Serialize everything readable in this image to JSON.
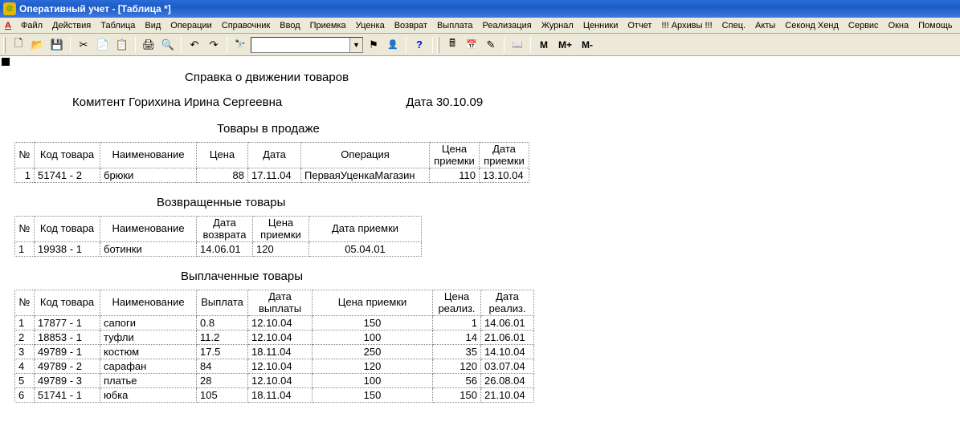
{
  "window": {
    "title": "Оперативный учет - [Таблица  *]"
  },
  "menu": [
    "Файл",
    "Действия",
    "Таблица",
    "Вид",
    "Операции",
    "Справочник",
    "Ввод",
    "Приемка",
    "Уценка",
    "Возврат",
    "Выплата",
    "Реализация",
    "Журнал",
    "Ценники",
    "Отчет",
    "!!! Архивы !!!",
    "Спец.",
    "Акты",
    "Секонд Хенд",
    "Сервис",
    "Окна",
    "Помощь"
  ],
  "tb": {
    "m": "M",
    "mplus": "M+",
    "mminus": "M-"
  },
  "report": {
    "title": "Справка о движении товаров",
    "komitent_label": "Комитент",
    "komitent_name": "Горихина Ирина Сергеевна",
    "date_label": "Дата",
    "date_value": "30.10.09"
  },
  "sections": {
    "sale": {
      "title": "Товары в продаже",
      "cols": [
        "№",
        "Код товара",
        "Наименование",
        "Цена",
        "Дата",
        "Операция",
        "Цена приемки",
        "Дата приемки"
      ],
      "rows": [
        {
          "n": "1",
          "code": "51741 - 2",
          "name": "брюки",
          "price": "88",
          "date": "17.11.04",
          "op": "ПерваяУценкаМагазин",
          "pprice": "110",
          "pdate": "13.10.04"
        }
      ]
    },
    "returned": {
      "title": "Возвращенные товары",
      "cols": [
        "№",
        "Код товара",
        "Наименование",
        "Дата возврата",
        "Цена приемки",
        "Дата приемки"
      ],
      "rows": [
        {
          "n": "1",
          "code": "19938 - 1",
          "name": "ботинки",
          "rdate": "14.06.01",
          "pprice": "120",
          "pdate": "05.04.01"
        }
      ]
    },
    "paid": {
      "title": "Выплаченные товары",
      "cols": [
        "№",
        "Код товара",
        "Наименование",
        "Выплата",
        "Дата выплаты",
        "Цена приемки",
        "Цена реализ.",
        "Дата реализ."
      ],
      "rows": [
        {
          "n": "1",
          "code": "17877 - 1",
          "name": "сапоги",
          "pay": "0.8",
          "pdate": "12.10.04",
          "pprice": "150",
          "rprice": "1",
          "rdate": "14.06.01"
        },
        {
          "n": "2",
          "code": "18853 - 1",
          "name": "туфли",
          "pay": "11.2",
          "pdate": "12.10.04",
          "pprice": "100",
          "rprice": "14",
          "rdate": "21.06.01"
        },
        {
          "n": "3",
          "code": "49789 - 1",
          "name": "костюм",
          "pay": "17.5",
          "pdate": "18.11.04",
          "pprice": "250",
          "rprice": "35",
          "rdate": "14.10.04"
        },
        {
          "n": "4",
          "code": "49789 - 2",
          "name": "сарафан",
          "pay": "84",
          "pdate": "12.10.04",
          "pprice": "120",
          "rprice": "120",
          "rdate": "03.07.04"
        },
        {
          "n": "5",
          "code": "49789 - 3",
          "name": "платье",
          "pay": "28",
          "pdate": "12.10.04",
          "pprice": "100",
          "rprice": "56",
          "rdate": "26.08.04"
        },
        {
          "n": "6",
          "code": "51741 - 1",
          "name": "юбка",
          "pay": "105",
          "pdate": "18.11.04",
          "pprice": "150",
          "rprice": "150",
          "rdate": "21.10.04"
        }
      ]
    }
  }
}
